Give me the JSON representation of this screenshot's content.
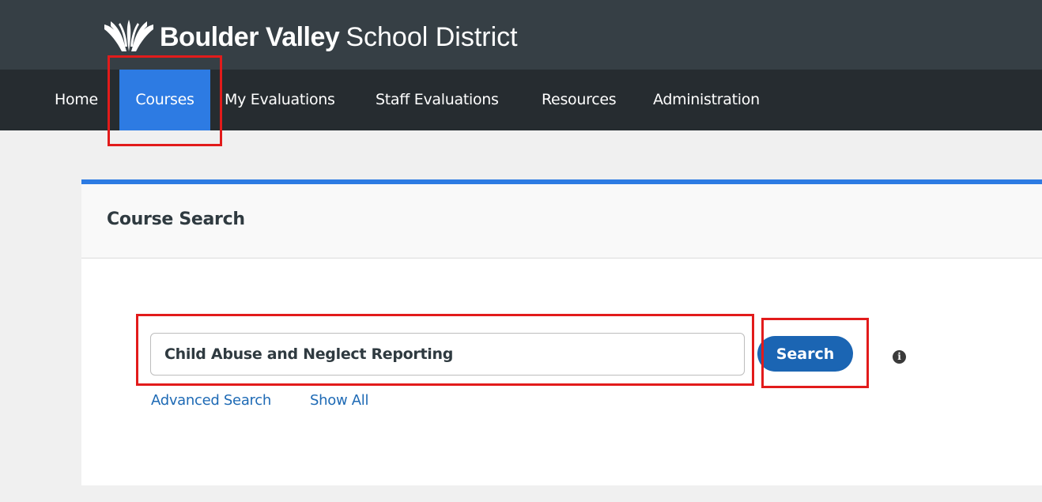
{
  "header": {
    "logo_bold": "Boulder Valley",
    "logo_light": "School District",
    "logo_icon": "bvsd-leaf-icon",
    "background_color": "#363f45"
  },
  "nav": {
    "items": [
      {
        "label": "Home",
        "active": false
      },
      {
        "label": "Courses",
        "active": true
      },
      {
        "label": "My Evaluations",
        "active": false
      },
      {
        "label": "Staff Evaluations",
        "active": false
      },
      {
        "label": "Resources",
        "active": false
      },
      {
        "label": "Administration",
        "active": false
      }
    ],
    "active_color": "#2d7be3",
    "background_color": "#262c30"
  },
  "course_search": {
    "title": "Course Search",
    "search_value": "Child Abuse and Neglect Reporting",
    "search_button_label": "Search",
    "info_icon": "info-icon",
    "links": {
      "advanced_search": "Advanced Search",
      "show_all": "Show All"
    }
  },
  "colors": {
    "accent": "#2d7be3",
    "button": "#1b65b3",
    "link": "#1e6ab5",
    "highlight_box": "#e21b1b"
  }
}
